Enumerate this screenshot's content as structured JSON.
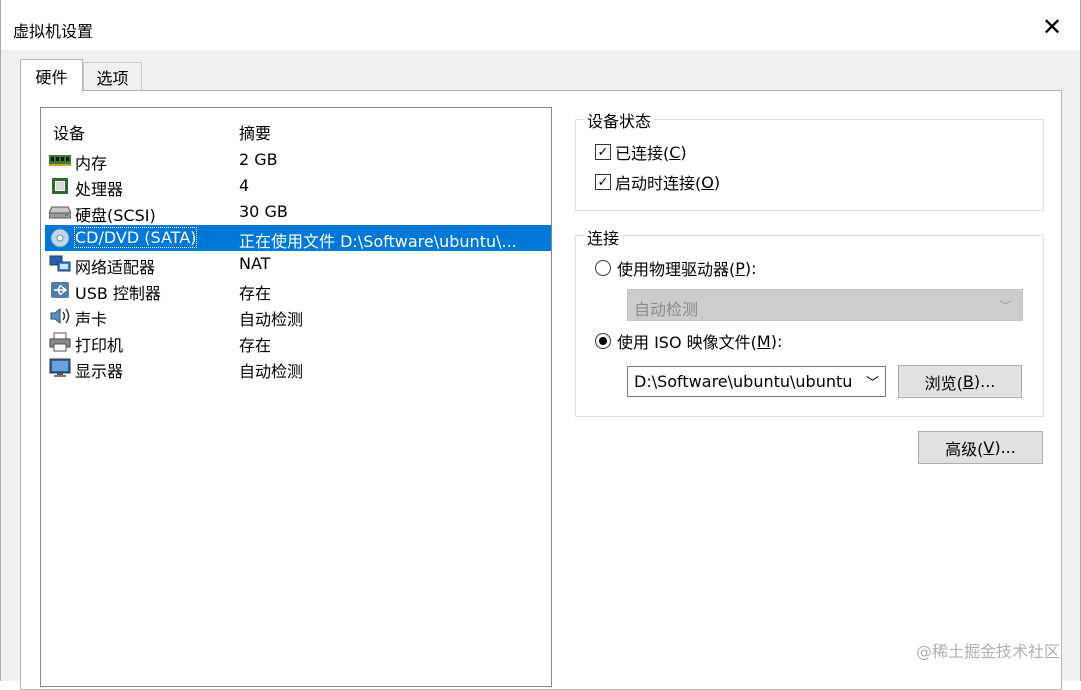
{
  "window": {
    "title": "虚拟机设置",
    "close_glyph": "✕"
  },
  "tabs": [
    {
      "label": "硬件",
      "active": true
    },
    {
      "label": "选项",
      "active": false
    }
  ],
  "device_list": {
    "headers": {
      "device": "设备",
      "summary": "摘要"
    },
    "rows": [
      {
        "icon": "memory-icon",
        "name": "内存",
        "summary": "2 GB"
      },
      {
        "icon": "processor-icon",
        "name": "处理器",
        "summary": "4"
      },
      {
        "icon": "harddisk-icon",
        "name": "硬盘(SCSI)",
        "summary": "30 GB"
      },
      {
        "icon": "cd-dvd-icon",
        "name": "CD/DVD (SATA)",
        "summary": "正在使用文件 D:\\Software\\ubuntu\\...",
        "selected": true
      },
      {
        "icon": "network-adapter-icon",
        "name": "网络适配器",
        "summary": "NAT"
      },
      {
        "icon": "usb-icon",
        "name": "USB 控制器",
        "summary": "存在"
      },
      {
        "icon": "sound-icon",
        "name": "声卡",
        "summary": "自动检测"
      },
      {
        "icon": "printer-icon",
        "name": "打印机",
        "summary": "存在"
      },
      {
        "icon": "display-icon",
        "name": "显示器",
        "summary": "自动检测"
      }
    ]
  },
  "device_status": {
    "title": "设备状态",
    "connected": {
      "label": "已连接(",
      "key": "C",
      "suffix": ")",
      "checked": true
    },
    "connect_at_power_on": {
      "label": "启动时连接(",
      "key": "O",
      "suffix": ")",
      "checked": true
    }
  },
  "connection": {
    "title": "连接",
    "physical_drive": {
      "label": "使用物理驱动器(",
      "key": "P",
      "suffix": "):",
      "selected": false
    },
    "physical_drive_value": "自动检测",
    "iso_image": {
      "label": "使用 ISO 映像文件(",
      "key": "M",
      "suffix": "):",
      "selected": true
    },
    "iso_path": "D:\\Software\\ubuntu\\ubuntu",
    "browse_button": {
      "label": "浏览(",
      "key": "B",
      "suffix": ")..."
    }
  },
  "advanced_button": {
    "label": "高级(",
    "key": "V",
    "suffix": ")..."
  },
  "watermark": "@稀土掘金技术社区",
  "colors": {
    "selection": "#0078d7",
    "window_bg": "#f0f0f0"
  }
}
